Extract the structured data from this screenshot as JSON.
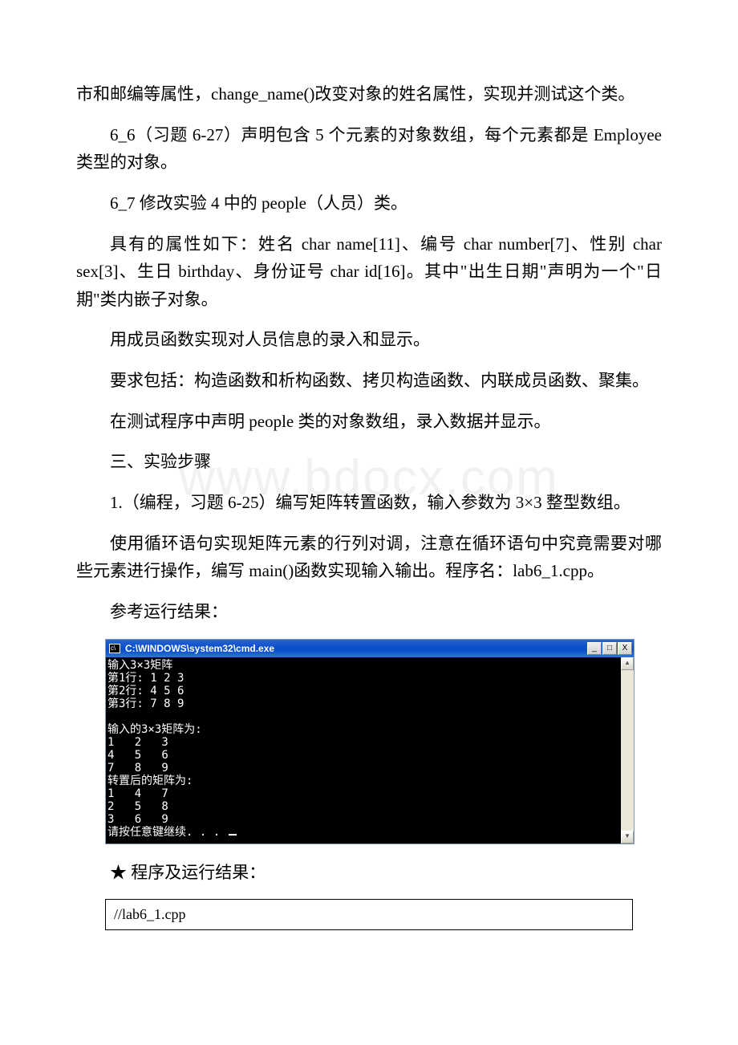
{
  "watermark": "www.bdocx.com",
  "paragraphs": {
    "p1": "市和邮编等属性，change_name()改变对象的姓名属性，实现并测试这个类。",
    "p2": "6_6（习题 6-27）声明包含 5 个元素的对象数组，每个元素都是 Employee 类型的对象。",
    "p3": "6_7 修改实验 4 中的 people（人员）类。",
    "p4": "具有的属性如下：姓名 char name[11]、编号 char number[7]、性别 char sex[3]、生日 birthday、身份证号 char id[16]。其中\"出生日期\"声明为一个\"日期\"类内嵌子对象。",
    "p5": "用成员函数实现对人员信息的录入和显示。",
    "p6": "要求包括：构造函数和析构函数、拷贝构造函数、内联成员函数、聚集。",
    "p7": "在测试程序中声明 people 类的对象数组，录入数据并显示。",
    "p8": "三、实验步骤",
    "p9": "1.（编程，习题 6-25）编写矩阵转置函数，输入参数为 3×3 整型数组。",
    "p10": "使用循环语句实现矩阵元素的行列对调，注意在循环语句中究竟需要对哪些元素进行操作，编写 main()函数实现输入输出。程序名：lab6_1.cpp。",
    "p11": "参考运行结果：",
    "p12": "★ 程序及运行结果："
  },
  "console": {
    "title": "C:\\WINDOWS\\system32\\cmd.exe",
    "icon_text": "c\\",
    "btn_min": "_",
    "btn_max": "□",
    "btn_close": "X",
    "sb_up": "▲",
    "sb_down": "▼",
    "lines": [
      "输入3×3矩阵",
      "第1行: 1 2 3",
      "第2行: 4 5 6",
      "第3行: 7 8 9",
      "",
      "输入的3×3矩阵为:",
      "1   2   3",
      "4   5   6",
      "7   8   9",
      "转置后的矩阵为:",
      "1   4   7",
      "2   5   8",
      "3   6   9",
      "请按任意键继续. . . "
    ]
  },
  "codebox": {
    "line1": "//lab6_1.cpp"
  }
}
